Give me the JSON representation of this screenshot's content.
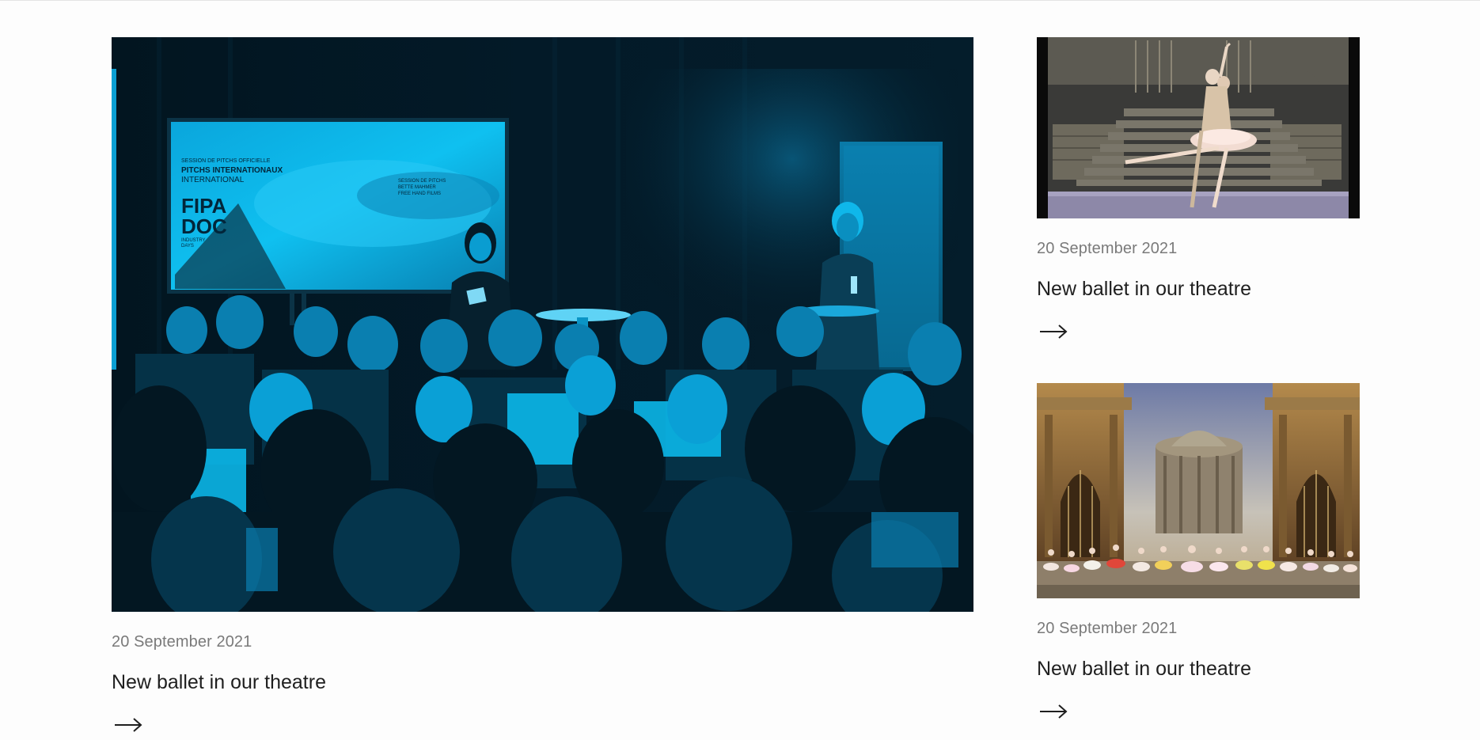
{
  "articles": [
    {
      "date": "20 September 2021",
      "title": "New ballet in our theatre",
      "image_text": {
        "session": "SESSION DE PITCHS OFFICIELLE",
        "pitchs": "PITCHS INTERNATIONAUX",
        "international": "INTERNATIONAL",
        "logo_line1": "FIPA",
        "logo_line2": "DOC",
        "logo_sub1": "INDUSTRY",
        "logo_sub2": "DAYS",
        "right_caption1": "SESSION DE PITCHS",
        "right_caption2": "BETTE MAHMER",
        "right_caption3": "FREE HAND FILMS"
      }
    },
    {
      "date": "20 September 2021",
      "title": "New ballet in our theatre"
    },
    {
      "date": "20 September 2021",
      "title": "New ballet in our theatre"
    }
  ],
  "icons": {
    "read_more": "arrow-right-icon"
  },
  "colors": {
    "duotone_cyan": "#00a8e0",
    "duotone_dark": "#02141f",
    "date_gray": "#7a7a7a",
    "title_dark": "#1f1f1f"
  }
}
